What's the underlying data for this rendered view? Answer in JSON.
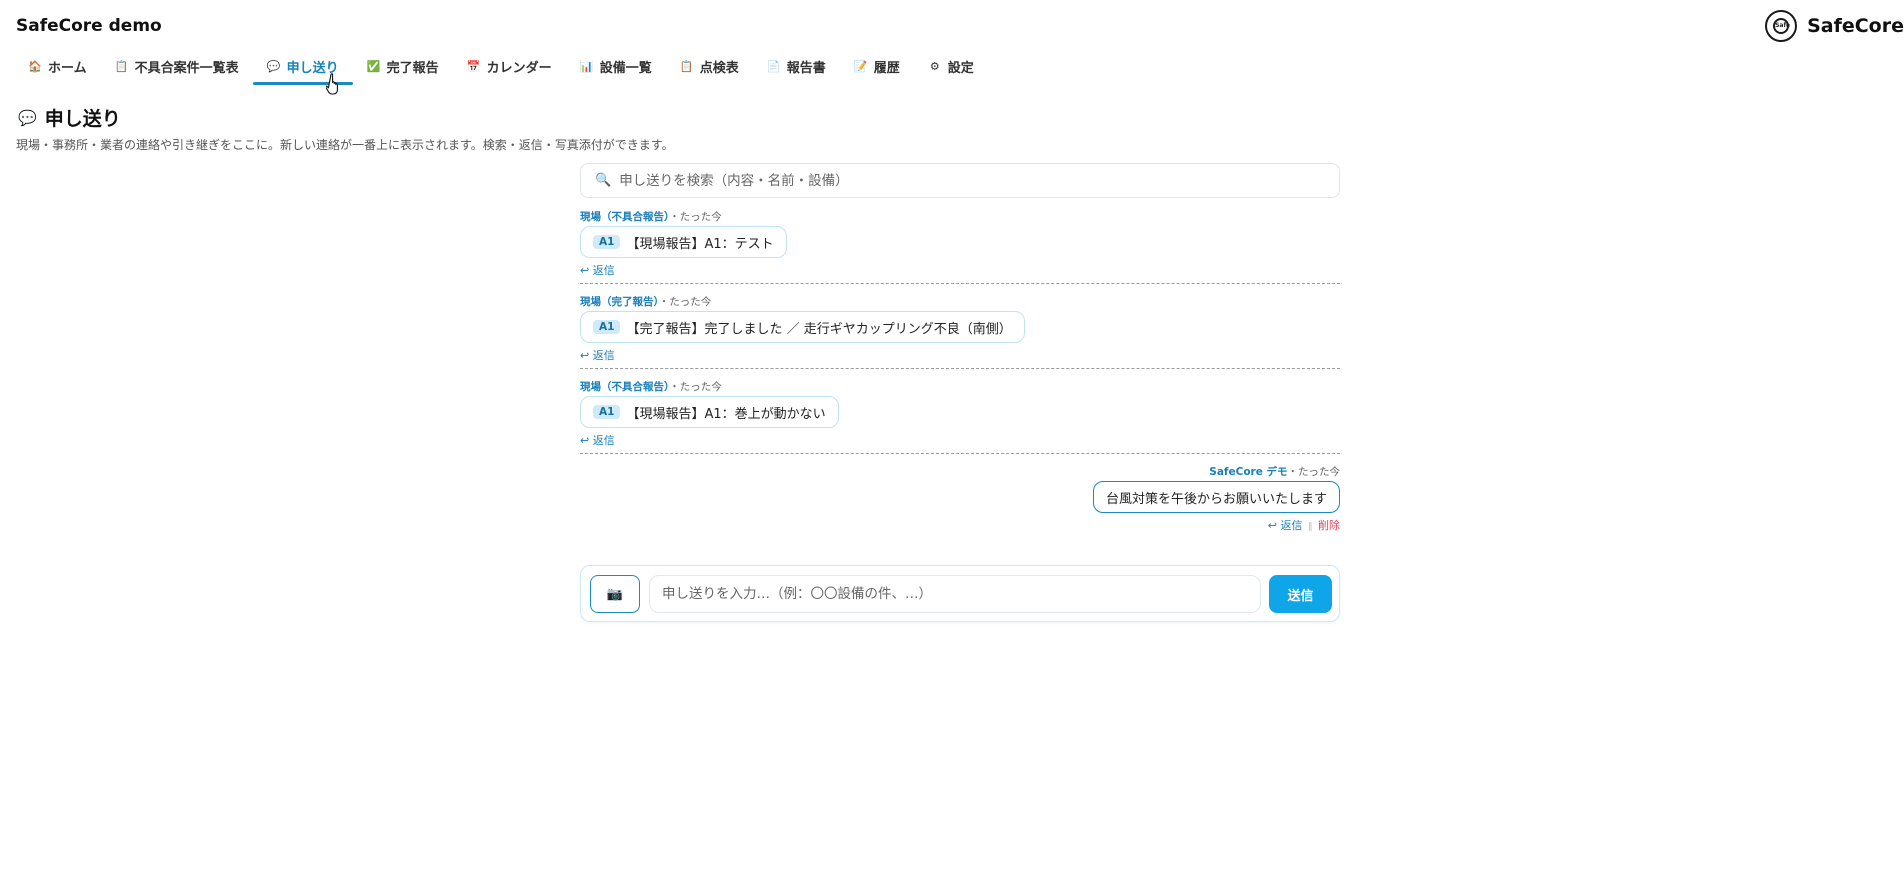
{
  "app": {
    "title": "SafeCore demo",
    "brand_name": "SafeCore",
    "brand_logo_text": "Safe"
  },
  "nav": {
    "tabs": [
      {
        "label": "ホーム",
        "icon": "house-icon",
        "glyph": "🏠"
      },
      {
        "label": "不具合案件一覧表",
        "icon": "clipboard-icon",
        "glyph": "📋"
      },
      {
        "label": "申し送り",
        "icon": "speech-bubble-icon",
        "glyph": "💬",
        "active": true
      },
      {
        "label": "完了報告",
        "icon": "check-icon",
        "glyph": "✅"
      },
      {
        "label": "カレンダー",
        "icon": "calendar-icon",
        "glyph": "📅"
      },
      {
        "label": "設備一覧",
        "icon": "chart-icon",
        "glyph": "📊"
      },
      {
        "label": "点検表",
        "icon": "clipboard-icon",
        "glyph": "📋"
      },
      {
        "label": "報告書",
        "icon": "document-icon",
        "glyph": "📄"
      },
      {
        "label": "履歴",
        "icon": "memo-icon",
        "glyph": "📝"
      },
      {
        "label": "設定",
        "icon": "gear-icon",
        "glyph": "⚙"
      }
    ]
  },
  "page": {
    "icon": "speech-bubble-icon",
    "title": "申し送り",
    "description": "現場・事務所・業者の連絡や引き継ぎをここに。新しい連絡が一番上に表示されます。検索・返信・写真添付ができます。"
  },
  "search": {
    "placeholder": "申し送りを検索（内容・名前・設備）",
    "icon": "search-icon",
    "glyph": "🔍"
  },
  "messages": [
    {
      "author": "現場（不具合報告）",
      "time": "・たった今",
      "badge": "A1",
      "text": "【現場報告】A1：テスト",
      "reply_label": "↩ 返信"
    },
    {
      "author": "現場（完了報告）",
      "time": "・たった今",
      "badge": "A1",
      "text": "【完了報告】完了しました ／ 走行ギヤカップリング不良（南側）",
      "reply_label": "↩ 返信"
    },
    {
      "author": "現場（不具合報告）",
      "time": "・たった今",
      "badge": "A1",
      "text": "【現場報告】A1：巻上が動かない",
      "reply_label": "↩ 返信"
    },
    {
      "author": "SafeCore デモ",
      "time": "・たった今",
      "text": "台風対策を午後からお願いいたします",
      "reply_label": "↩ 返信",
      "separator": "‖",
      "delete_label": "削除"
    }
  ],
  "composer": {
    "camera_icon": "camera-icon",
    "camera_glyph": "📷",
    "placeholder": "申し送りを入力…（例：〇〇設備の件、…）",
    "send_label": "送信"
  },
  "colors": {
    "accent": "#1a8bc2",
    "send_button": "#0ea5e9",
    "delete": "#e0405a",
    "badge_bg": "#cfeaf8"
  }
}
